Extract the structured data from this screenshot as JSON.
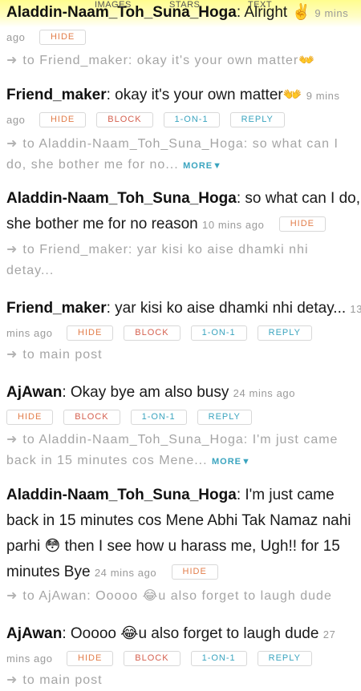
{
  "tabs": {
    "images": "IMAGES",
    "stars": "STARS",
    "text": "TEXT"
  },
  "labels": {
    "hide": "HIDE",
    "block": "BLOCK",
    "one_on_one": "1-ON-1",
    "reply": "REPLY",
    "more": "MORE"
  },
  "posts": [
    {
      "user": "Aladdin-Naam_Toh_Suna_Hoga",
      "message": ": Alright ",
      "emoji": "✌️",
      "time_a": "9 mins",
      "time_b": "ago",
      "reply_to_a": "to Friend_maker: okay it's your own matter",
      "reply_to_emoji": "👐"
    },
    {
      "user": "Friend_maker",
      "message": ": okay it's your own matter",
      "emoji": "👐",
      "time_a": "9 mins",
      "time_b": "ago",
      "reply_to_a": "to Aladdin-Naam_Toh_Suna_Hoga: so what can I",
      "reply_to_b": "do, she bother me for no..."
    },
    {
      "user": "Aladdin-Naam_Toh_Suna_Hoga",
      "message_a": ": so what can I do,",
      "message_b": "she bother me for no reason",
      "time": "10 mins ago",
      "reply_to_a": "to Friend_maker: yar kisi ko aise dhamki nhi",
      "reply_to_b": "detay..."
    },
    {
      "user": "Friend_maker",
      "message": ": yar kisi ko aise dhamki nhi detay...",
      "time_a": "13",
      "time_b": "mins ago",
      "reply_to": "to main post"
    },
    {
      "user": "AjAwan",
      "message": ": Okay bye am also busy",
      "time": "24 mins ago",
      "reply_to_a": "to Aladdin-Naam_Toh_Suna_Hoga: I'm just came",
      "reply_to_b": "back in 15 minutes cos Mene..."
    },
    {
      "user": "Aladdin-Naam_Toh_Suna_Hoga",
      "message_a": ": I'm just came",
      "message_b": "back in 15 minutes cos Mene Abhi Tak Namaz nahi",
      "message_c1": "parhi ",
      "emoji": "😳",
      "message_c2": " then I see how u harass me, Ugh!! for 15",
      "message_d": "minutes Bye",
      "time": "24 mins ago",
      "reply_to_a": "to AjAwan: Ooooo ",
      "reply_emoji": "😂",
      "reply_to_b": "u also forget to laugh dude"
    },
    {
      "user": "AjAwan",
      "message_a": ": Ooooo ",
      "emoji": "😂",
      "message_b": "u also forget to laugh dude",
      "time_a": "27",
      "time_b": "mins ago",
      "reply_to": "to main post"
    }
  ]
}
